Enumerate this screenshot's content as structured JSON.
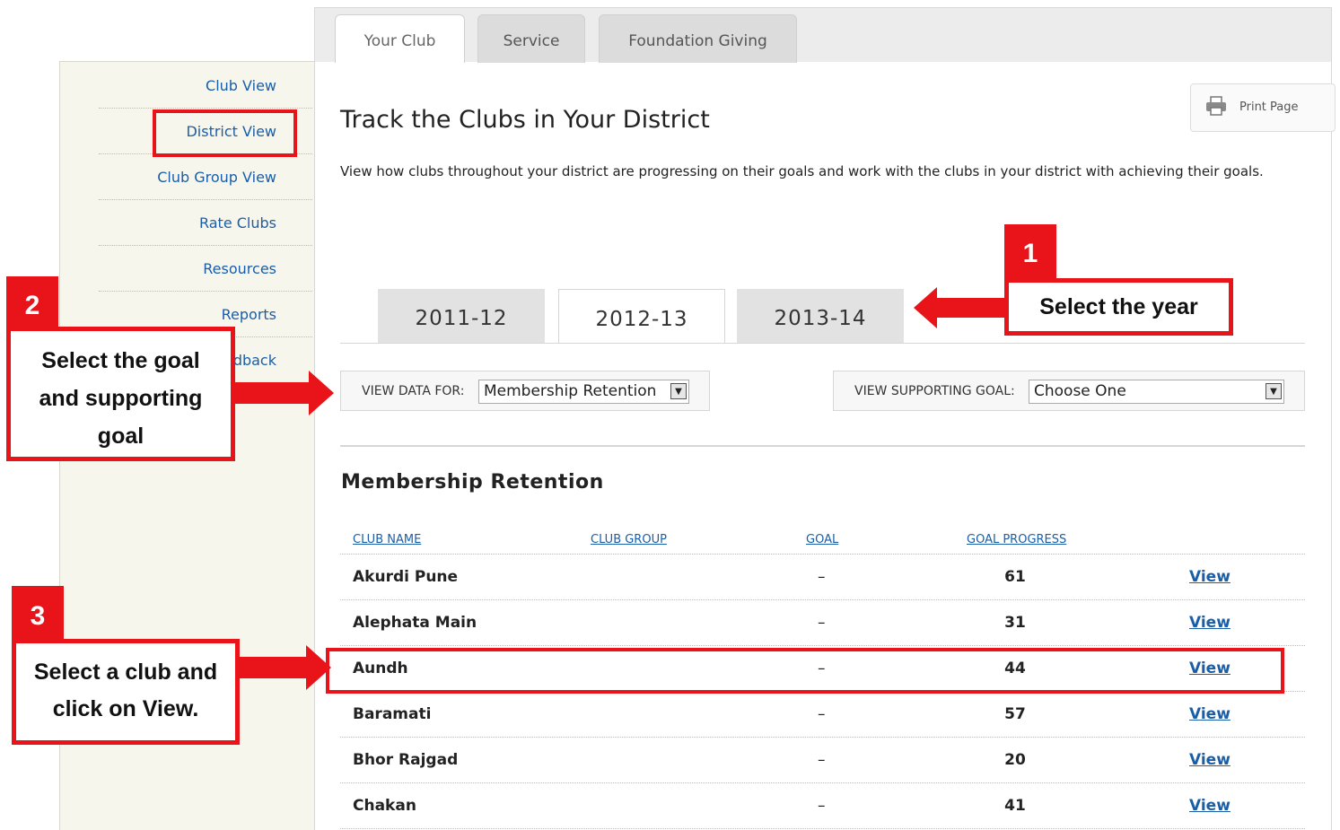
{
  "tabs": [
    {
      "label": "Your Club",
      "active": true
    },
    {
      "label": "Service",
      "active": false
    },
    {
      "label": "Foundation Giving",
      "active": false
    }
  ],
  "sidebar": {
    "items": [
      {
        "label": "Club View"
      },
      {
        "label": "District View",
        "selected": true
      },
      {
        "label": "Club Group View"
      },
      {
        "label": "Rate Clubs"
      },
      {
        "label": "Resources"
      },
      {
        "label": "Reports"
      },
      {
        "label": "Feedback"
      }
    ]
  },
  "print_button": {
    "label": "Print Page",
    "icon": "printer-icon"
  },
  "page": {
    "title": "Track the Clubs in Your District",
    "description": "View how clubs throughout your district are progressing on their goals and work with the clubs in your district with achieving their goals."
  },
  "years": [
    {
      "label": "2011-12",
      "active": false
    },
    {
      "label": "2012-13",
      "active": true
    },
    {
      "label": "2013-14",
      "active": false
    }
  ],
  "filters": {
    "view_data_label": "VIEW DATA FOR:",
    "view_data_value": "Membership Retention",
    "supporting_goal_label": "VIEW SUPPORTING GOAL:",
    "supporting_goal_value": "Choose One"
  },
  "section_title": "Membership Retention",
  "table": {
    "headers": [
      "CLUB NAME",
      "CLUB GROUP",
      "GOAL",
      "GOAL PROGRESS"
    ],
    "rows": [
      {
        "name": "Akurdi Pune",
        "goal": "–",
        "progress": "61",
        "action": "View"
      },
      {
        "name": "Alephata Main",
        "goal": "–",
        "progress": "31",
        "action": "View"
      },
      {
        "name": "Aundh",
        "goal": "–",
        "progress": "44",
        "action": "View"
      },
      {
        "name": "Baramati",
        "goal": "–",
        "progress": "57",
        "action": "View"
      },
      {
        "name": "Bhor Rajgad",
        "goal": "–",
        "progress": "20",
        "action": "View"
      },
      {
        "name": "Chakan",
        "goal": "–",
        "progress": "41",
        "action": "View"
      }
    ]
  },
  "annotations": {
    "step1_number": "1",
    "step1_text": "Select the year",
    "step2_number": "2",
    "step2_text": "Select the goal and supporting goal",
    "step3_number": "3",
    "step3_text": "Select a club and click on View.",
    "accent_color": "#e8141a"
  }
}
